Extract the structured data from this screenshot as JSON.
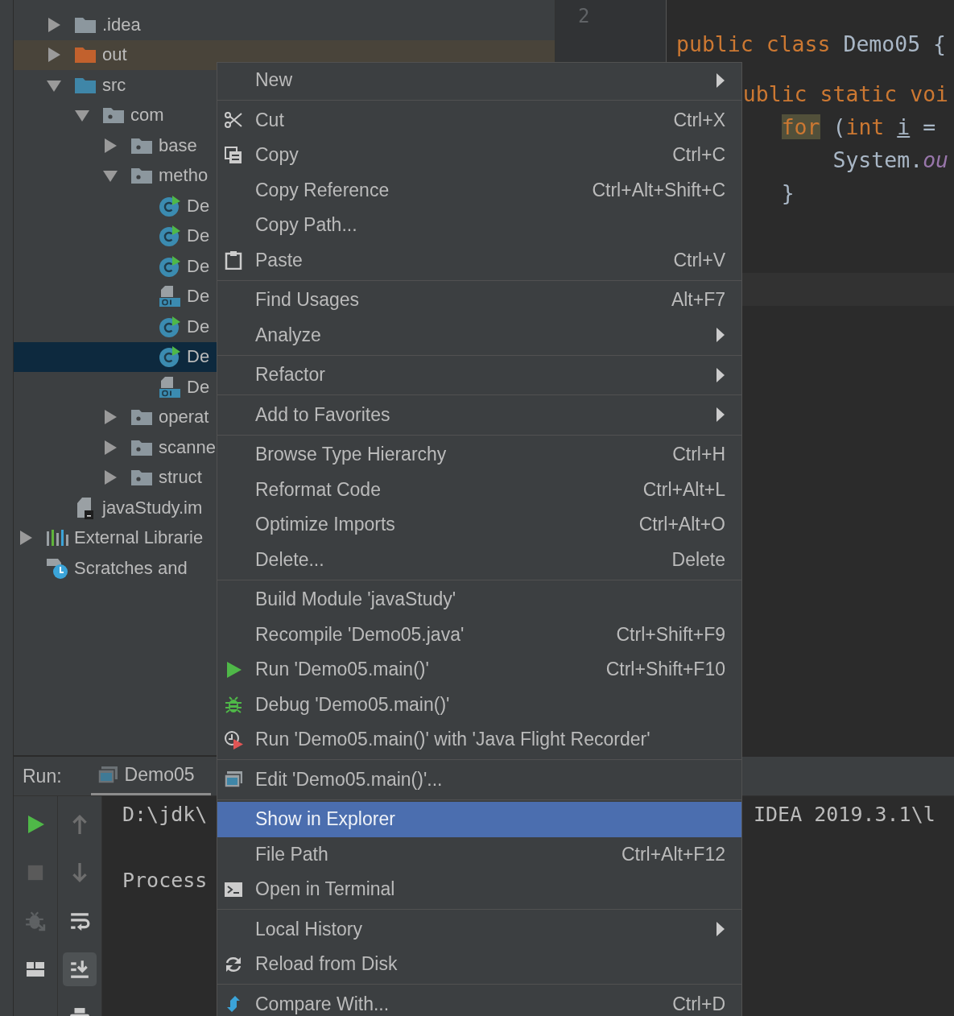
{
  "project_tree": {
    "items": [
      {
        "label": ".idea",
        "kind": "folder",
        "expanded": false,
        "selected": false
      },
      {
        "label": "out",
        "kind": "excluded-folder",
        "expanded": false,
        "selected": false
      },
      {
        "label": "src",
        "kind": "source-folder",
        "expanded": true,
        "selected": false,
        "children": [
          {
            "label": "com",
            "kind": "package",
            "expanded": true,
            "selected": false,
            "children": [
              {
                "label": "base",
                "kind": "package",
                "expanded": false,
                "selected": false
              },
              {
                "label": "metho",
                "kind": "package",
                "expanded": true,
                "selected": false,
                "children": [
                  {
                    "label": "De",
                    "kind": "class",
                    "selected": false
                  },
                  {
                    "label": "De",
                    "kind": "class",
                    "selected": false
                  },
                  {
                    "label": "De",
                    "kind": "class",
                    "selected": false
                  },
                  {
                    "label": "De",
                    "kind": "class-file",
                    "selected": false
                  },
                  {
                    "label": "De",
                    "kind": "class",
                    "selected": false
                  },
                  {
                    "label": "De",
                    "kind": "class",
                    "selected": true
                  },
                  {
                    "label": "De",
                    "kind": "class-file",
                    "selected": false
                  }
                ]
              },
              {
                "label": "operat",
                "kind": "package",
                "expanded": false,
                "selected": false
              },
              {
                "label": "scanne",
                "kind": "package",
                "expanded": false,
                "selected": false
              },
              {
                "label": "struct",
                "kind": "package",
                "expanded": false,
                "selected": false
              }
            ]
          }
        ]
      },
      {
        "label": "javaStudy.im",
        "kind": "module-file",
        "selected": false
      }
    ],
    "extra_roots": [
      {
        "label": "External Librarie",
        "kind": "libraries",
        "expanded": false,
        "selected": false
      },
      {
        "label": "Scratches and",
        "kind": "scratches",
        "selected": false
      }
    ]
  },
  "editor": {
    "line_numbers": [
      "2"
    ],
    "lines": [
      [
        {
          "text": "public class ",
          "kind": "keyword"
        },
        {
          "text": "Demo05 {",
          "kind": "plain"
        }
      ],
      [
        {
          "text": "ublic static voi",
          "kind": "keyword"
        }
      ],
      [
        {
          "text": "for",
          "kind": "keyword-match"
        },
        {
          "text": " (",
          "kind": "plain"
        },
        {
          "text": "int ",
          "kind": "keyword"
        },
        {
          "text": "i",
          "kind": "variable"
        },
        {
          "text": " =",
          "kind": "plain"
        }
      ],
      [
        {
          "text": "System.",
          "kind": "plain"
        },
        {
          "text": "ou",
          "kind": "field"
        }
      ],
      [
        {
          "text": "}",
          "kind": "plain"
        }
      ]
    ]
  },
  "run_panel": {
    "label": "Run:",
    "tab": {
      "label": "Demo05",
      "selected": true
    },
    "console_toolbar": [
      {
        "on": false
      },
      {
        "on": false
      },
      {
        "on": false
      },
      {
        "on": true
      },
      {
        "on": false
      }
    ],
    "console_lines": [
      {
        "left": "D:\\jdk\\",
        "right": "IDEA 2019.3.1\\l"
      },
      {
        "left": "Process"
      }
    ]
  },
  "context_menu": {
    "groups": [
      [
        {
          "label": "New",
          "submenu": true,
          "selected": false
        }
      ],
      [
        {
          "label": "Cut",
          "shortcut": "Ctrl+X",
          "submenu": false,
          "selected": false
        },
        {
          "label": "Copy",
          "shortcut": "Ctrl+C",
          "submenu": false,
          "selected": false
        },
        {
          "label": "Copy Reference",
          "shortcut": "Ctrl+Alt+Shift+C",
          "submenu": false,
          "selected": false
        },
        {
          "label": "Copy Path...",
          "submenu": false,
          "selected": false
        },
        {
          "label": "Paste",
          "shortcut": "Ctrl+V",
          "submenu": false,
          "selected": false
        }
      ],
      [
        {
          "label": "Find Usages",
          "shortcut": "Alt+F7",
          "submenu": false,
          "selected": false
        },
        {
          "label": "Analyze",
          "submenu": true,
          "selected": false
        }
      ],
      [
        {
          "label": "Refactor",
          "submenu": true,
          "selected": false
        }
      ],
      [
        {
          "label": "Add to Favorites",
          "submenu": true,
          "selected": false
        }
      ],
      [
        {
          "label": "Browse Type Hierarchy",
          "shortcut": "Ctrl+H",
          "submenu": false,
          "selected": false
        },
        {
          "label": "Reformat Code",
          "shortcut": "Ctrl+Alt+L",
          "submenu": false,
          "selected": false
        },
        {
          "label": "Optimize Imports",
          "shortcut": "Ctrl+Alt+O",
          "submenu": false,
          "selected": false
        },
        {
          "label": "Delete...",
          "shortcut": "Delete",
          "submenu": false,
          "selected": false
        }
      ],
      [
        {
          "label": "Build Module 'javaStudy'",
          "submenu": false,
          "selected": false
        },
        {
          "label": "Recompile 'Demo05.java'",
          "shortcut": "Ctrl+Shift+F9",
          "submenu": false,
          "selected": false
        },
        {
          "label": "Run 'Demo05.main()'",
          "shortcut": "Ctrl+Shift+F10",
          "submenu": false,
          "selected": false
        },
        {
          "label": "Debug 'Demo05.main()'",
          "submenu": false,
          "selected": false
        },
        {
          "label": "Run 'Demo05.main()' with 'Java Flight Recorder'",
          "submenu": false,
          "selected": false
        }
      ],
      [
        {
          "label": "Edit 'Demo05.main()'...",
          "submenu": false,
          "selected": false
        }
      ],
      [
        {
          "label": "Show in Explorer",
          "submenu": false,
          "selected": true
        },
        {
          "label": "File Path",
          "shortcut": "Ctrl+Alt+F12",
          "submenu": false,
          "selected": false
        },
        {
          "label": "Open in Terminal",
          "submenu": false,
          "selected": false
        }
      ],
      [
        {
          "label": "Local History",
          "submenu": true,
          "selected": false
        },
        {
          "label": "Reload from Disk",
          "submenu": false,
          "selected": false
        }
      ],
      [
        {
          "label": "Compare With...",
          "shortcut": "Ctrl+D",
          "submenu": false,
          "selected": false
        }
      ]
    ]
  }
}
